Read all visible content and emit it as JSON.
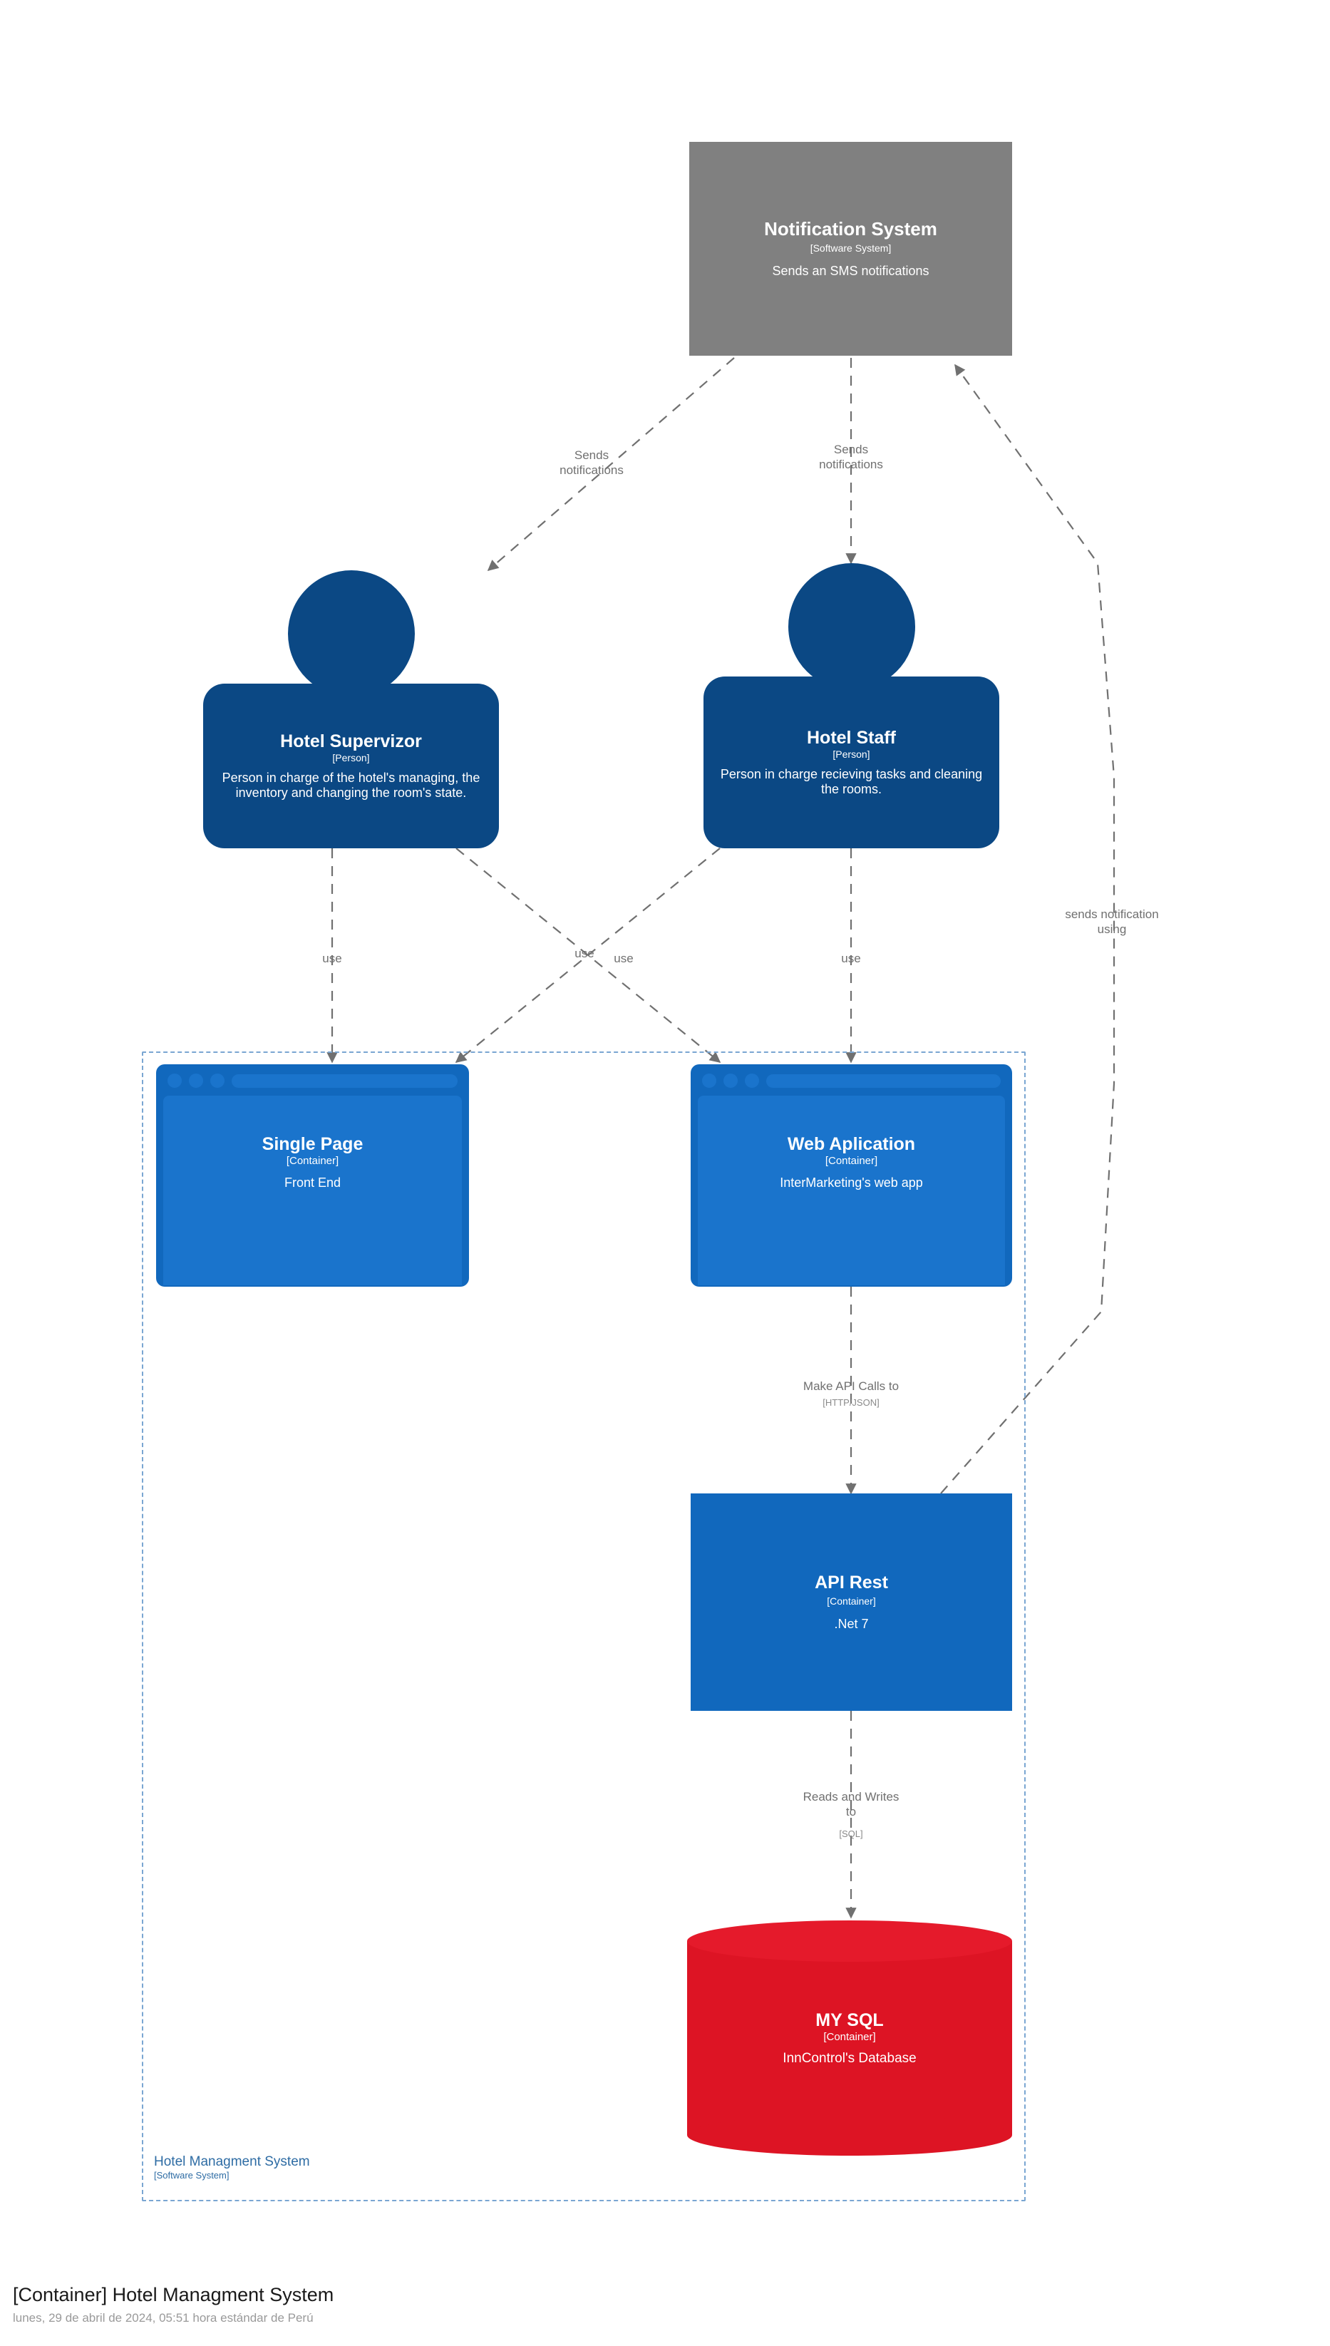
{
  "diagram": {
    "kind": "C4 Container Diagram",
    "boundary": {
      "name": "Hotel Managment System",
      "type": "[Software System]"
    },
    "caption": {
      "title": "[Container] Hotel Managment System",
      "timestamp": "lunes, 29 de abril de 2024, 05:51 hora estándar de Perú"
    },
    "colors": {
      "person": "#0b4884",
      "container": "#1168bd",
      "container_inner": "#1a74cc",
      "external_system": "#808080",
      "database": "#dd1424",
      "boundary_stroke": "#7aa6d2",
      "boundary_text": "#2e6ca4",
      "edge": "#707070"
    },
    "nodes": [
      {
        "id": "notification-system",
        "name": "Notification System",
        "type": "[Software System]",
        "description": "Sends an SMS notifications",
        "shape": "box",
        "style": "external"
      },
      {
        "id": "hotel-supervizor",
        "name": "Hotel Supervizor",
        "type": "[Person]",
        "description": "Person in charge of the hotel's managing, the inventory and changing the room's state.",
        "shape": "person",
        "style": "person"
      },
      {
        "id": "hotel-staff",
        "name": "Hotel Staff",
        "type": "[Person]",
        "description": "Person in charge recieving tasks and cleaning the rooms.",
        "shape": "person",
        "style": "person"
      },
      {
        "id": "single-page",
        "name": "Single Page",
        "type": "[Container]",
        "description": "Front End",
        "shape": "browser",
        "style": "container"
      },
      {
        "id": "web-aplication",
        "name": "Web Aplication",
        "type": "[Container]",
        "description": "InterMarketing's web app",
        "shape": "browser",
        "style": "container"
      },
      {
        "id": "api-rest",
        "name": "API Rest",
        "type": "[Container]",
        "description": ".Net 7",
        "shape": "box",
        "style": "container"
      },
      {
        "id": "my-sql",
        "name": "MY SQL",
        "type": "[Container]",
        "description": "InnControl's Database",
        "shape": "cylinder",
        "style": "database"
      }
    ],
    "edges": [
      {
        "id": "e1",
        "from": "notification-system",
        "to": "hotel-supervizor",
        "label": "Sends\nnotifications",
        "technology": ""
      },
      {
        "id": "e2",
        "from": "notification-system",
        "to": "hotel-staff",
        "label": "Sends\nnotifications",
        "technology": ""
      },
      {
        "id": "e3",
        "from": "hotel-supervizor",
        "to": "single-page",
        "label": "use",
        "technology": ""
      },
      {
        "id": "e4",
        "from": "hotel-supervizor",
        "to": "web-aplication",
        "label": "use",
        "technology": ""
      },
      {
        "id": "e5",
        "from": "hotel-staff",
        "to": "single-page",
        "label": "use",
        "technology": ""
      },
      {
        "id": "e6",
        "from": "hotel-staff",
        "to": "web-aplication",
        "label": "use",
        "technology": ""
      },
      {
        "id": "e7",
        "from": "web-aplication",
        "to": "api-rest",
        "label": "Make API Calls to",
        "technology": "[HTTP/JSON]"
      },
      {
        "id": "e8",
        "from": "api-rest",
        "to": "my-sql",
        "label": "Reads and Writes\nto",
        "technology": "[SQL]"
      },
      {
        "id": "e9",
        "from": "api-rest",
        "to": "notification-system",
        "label": "sends notification\nusing",
        "technology": ""
      }
    ]
  }
}
